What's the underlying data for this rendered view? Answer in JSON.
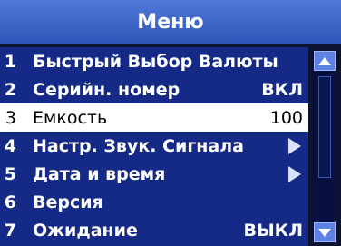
{
  "title": "Меню",
  "items": [
    {
      "num": "1",
      "label": "Быстрый Выбор Валюты",
      "value": "",
      "has_submenu": false,
      "selected": false
    },
    {
      "num": "2",
      "label": "Серийн. номер",
      "value": "ВКЛ",
      "has_submenu": false,
      "selected": false
    },
    {
      "num": "3",
      "label": "Емкость",
      "value": "100",
      "has_submenu": false,
      "selected": true
    },
    {
      "num": "4",
      "label": "Настр. Звук. Сигнала",
      "value": "",
      "has_submenu": true,
      "selected": false
    },
    {
      "num": "5",
      "label": "Дата и время",
      "value": "",
      "has_submenu": true,
      "selected": false
    },
    {
      "num": "6",
      "label": "Версия",
      "value": "",
      "has_submenu": false,
      "selected": false
    },
    {
      "num": "7",
      "label": "Ожидание",
      "value": "ВЫКЛ",
      "has_submenu": false,
      "selected": false
    }
  ],
  "icons": {
    "submenu": "arrow-right-icon",
    "scroll_up": "scroll-up-icon",
    "scroll_down": "scroll-down-icon"
  },
  "colors": {
    "title_bar": "#3f68c8",
    "menu_bg": "#142a86",
    "selected_bg": "#ffffff",
    "text": "#ffffff",
    "selected_text": "#000000"
  }
}
